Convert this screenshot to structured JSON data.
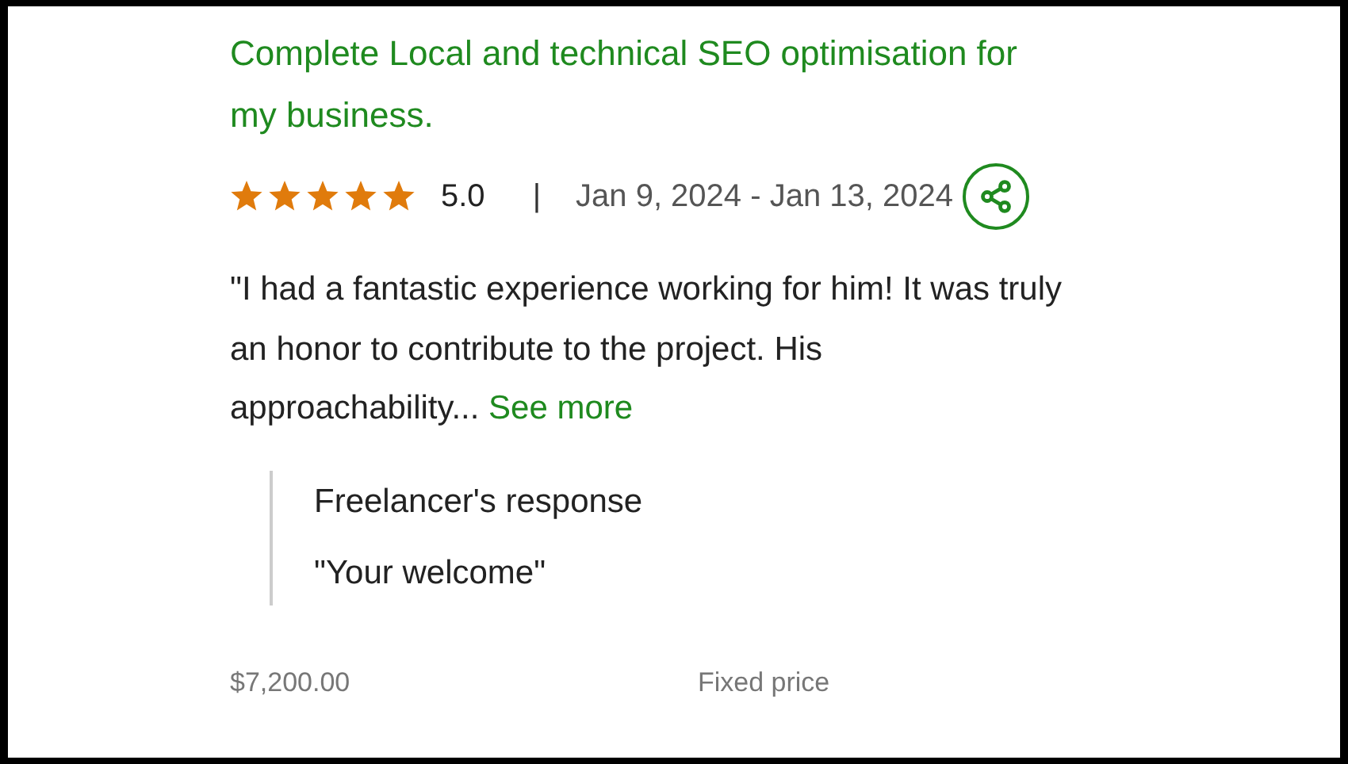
{
  "review": {
    "title": "Complete Local and technical SEO optimisation for my business.",
    "stars": 5,
    "rating": "5.0",
    "separator": "|",
    "dates": "Jan 9, 2024 - Jan 13, 2024",
    "comment": "\"I had a fantastic experience working for him! It was truly an honor to contribute to the project. His approachability...",
    "see_more": "See more",
    "response": {
      "heading": "Freelancer's response",
      "text": "\"Your welcome\""
    },
    "amount": "$7,200.00",
    "contract_type": "Fixed price"
  }
}
